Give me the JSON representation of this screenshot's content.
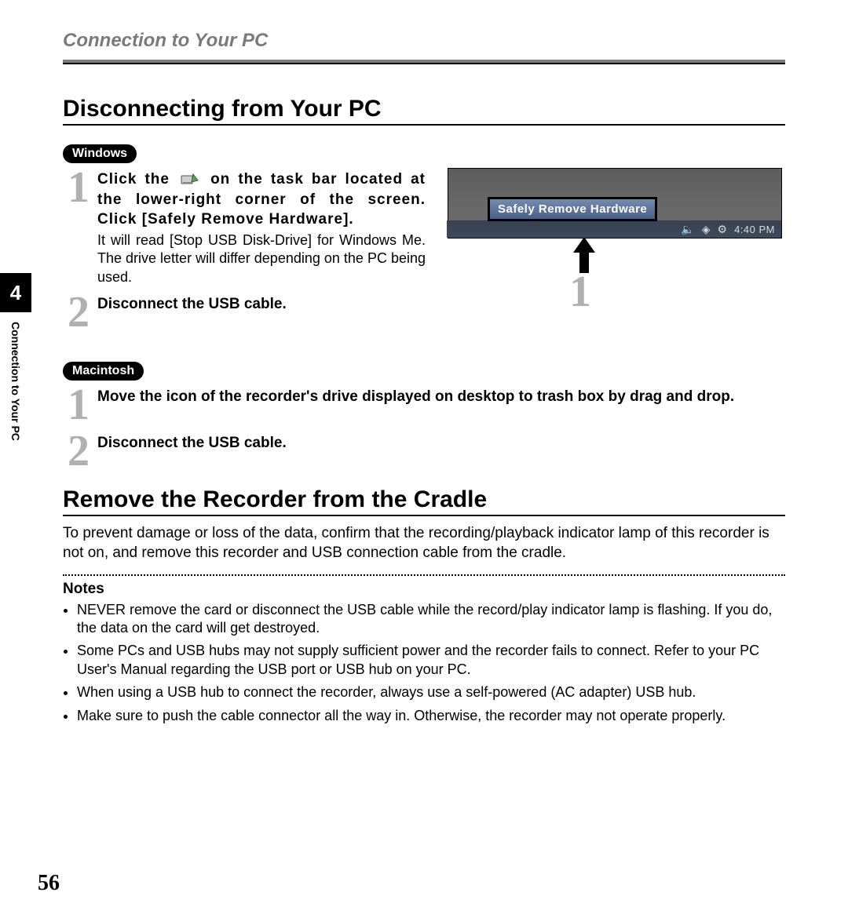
{
  "header": {
    "chapter_title": "Connection to Your PC"
  },
  "section1": {
    "title": "Disconnecting from Your PC"
  },
  "windows": {
    "pill": "Windows",
    "step1_bold_a": "Click the",
    "step1_bold_b": "on the task bar located at the lower-right corner of the screen. Click [Safely Remove Hardware].",
    "step1_desc": "It will read [Stop USB Disk-Drive] for Windows Me. The drive letter will differ depending on the PC being used.",
    "step2_bold": "Disconnect the USB cable."
  },
  "figure": {
    "tooltip": "Safely Remove Hardware",
    "time": "4:40 PM",
    "callout_num": "1"
  },
  "macintosh": {
    "pill": "Macintosh",
    "step1_bold": "Move the icon of the recorder's drive displayed on desktop to trash box by drag and drop.",
    "step2_bold": "Disconnect the USB cable."
  },
  "section2": {
    "title": "Remove the Recorder from the Cradle",
    "body": "To prevent damage or loss of the data, confirm that the recording/playback indicator lamp of this recorder is not on, and remove this recorder and USB connection cable from the cradle."
  },
  "notes": {
    "title": "Notes",
    "items": [
      "NEVER remove the card or disconnect the USB cable while the record/play indicator lamp is flashing. If you do, the data on the card will get destroyed.",
      "Some PCs and USB hubs may not supply sufficient power and the recorder fails to connect. Refer to your PC User's Manual regarding the USB port or USB hub on your PC.",
      "When using a USB hub to connect the recorder, always use a self-powered (AC adapter) USB hub.",
      "Make sure to push the cable connector all the way in. Otherwise, the recorder may not operate properly."
    ]
  },
  "sidebar": {
    "chapter_num": "4",
    "chapter_label": "Connection to Your PC"
  },
  "page_number": "56",
  "step_nums": {
    "n1": "1",
    "n2": "2"
  }
}
